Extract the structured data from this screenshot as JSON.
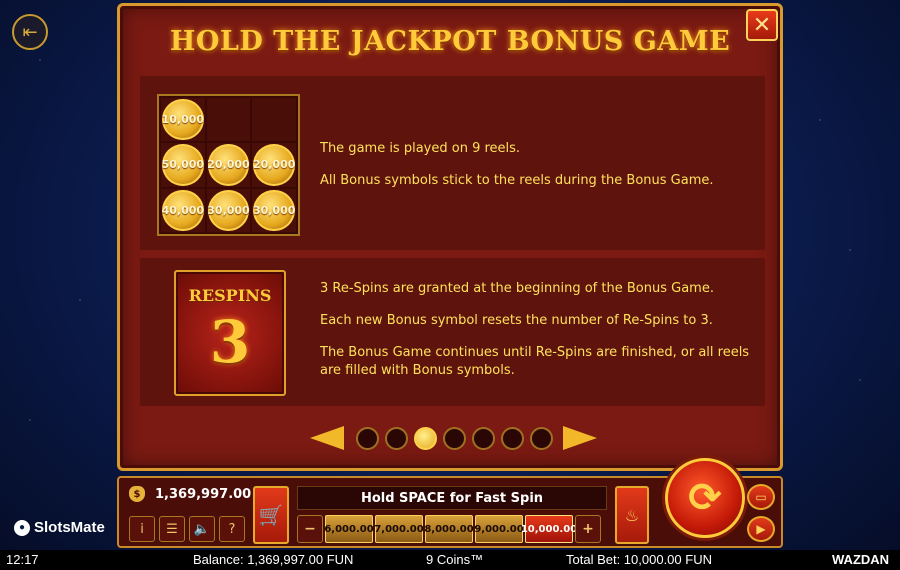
{
  "panel": {
    "title": "HOLD THE JACKPOT BONUS GAME",
    "close_label": "✕"
  },
  "section1": {
    "reel_cells": [
      "10,000",
      "",
      "",
      "50,000",
      "20,000",
      "20,000",
      "40,000",
      "30,000",
      "30,000"
    ],
    "lines": [
      "The game is played on 9 reels.",
      "All Bonus symbols stick to the reels during the Bonus Game."
    ]
  },
  "section2": {
    "respins_label": "RESPINS",
    "respins_count": "3",
    "lines": [
      "3 Re-Spins are granted at the beginning of the Bonus Game.",
      "Each new Bonus symbol resets the number of Re-Spins to 3.",
      "The Bonus Game continues until Re-Spins are finished, or all reels are filled with Bonus symbols."
    ]
  },
  "pager": {
    "pages": 7,
    "active_page": 3
  },
  "bottombar": {
    "balance": "1,369,997.00",
    "hold_space": "Hold SPACE for Fast Spin",
    "bet_minus": "−",
    "bet_plus": "+",
    "bets": [
      "6,000.00",
      "7,000.00",
      "8,000.00",
      "9,000.00",
      "10,000.00"
    ],
    "selected_bet": "10,000.00",
    "info_label": "i",
    "menu_label": "☰",
    "sound_label": "🔈",
    "help_label": "?"
  },
  "brand": {
    "name": "SlotsMate"
  },
  "status": {
    "time": "12:17",
    "balance": "Balance: 1,369,997.00 FUN",
    "game": "9 Coins™",
    "total_bet": "Total Bet: 10,000.00 FUN",
    "provider": "WAZDAN"
  },
  "icons": {
    "exit": "exit-icon",
    "close": "close-icon",
    "cart": "cart-icon",
    "flame": "flame-icon",
    "spin": "spin-icon"
  }
}
